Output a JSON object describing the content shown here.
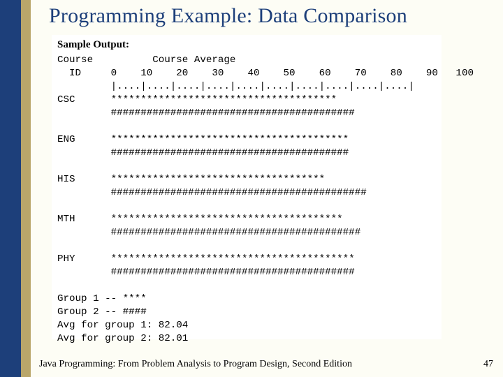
{
  "title": "Programming Example: Data Comparison",
  "sample_label": "Sample Output:",
  "header_line": "Course          Course Average",
  "scale_labels": "  ID     0    10    20    30    40    50    60    70    80    90   100",
  "scale_ticks": "         |....|....|....|....|....|....|....|....|....|....|",
  "rows": [
    {
      "id": "CSC",
      "bar1": "**************************************",
      "bar2": "#########################################"
    },
    {
      "id": "ENG",
      "bar1": "****************************************",
      "bar2": "########################################"
    },
    {
      "id": "HIS",
      "bar1": "************************************",
      "bar2": "###########################################"
    },
    {
      "id": "MTH",
      "bar1": "***************************************",
      "bar2": "##########################################"
    },
    {
      "id": "PHY",
      "bar1": "*****************************************",
      "bar2": "#########################################"
    }
  ],
  "legend": {
    "g1": "Group 1 -- ****",
    "g2": "Group 2 -- ####",
    "a1": "Avg for group 1: 82.04",
    "a2": "Avg for group 2: 82.01"
  },
  "footer": "Java Programming: From Problem Analysis to Program Design, Second Edition",
  "page": "47"
}
